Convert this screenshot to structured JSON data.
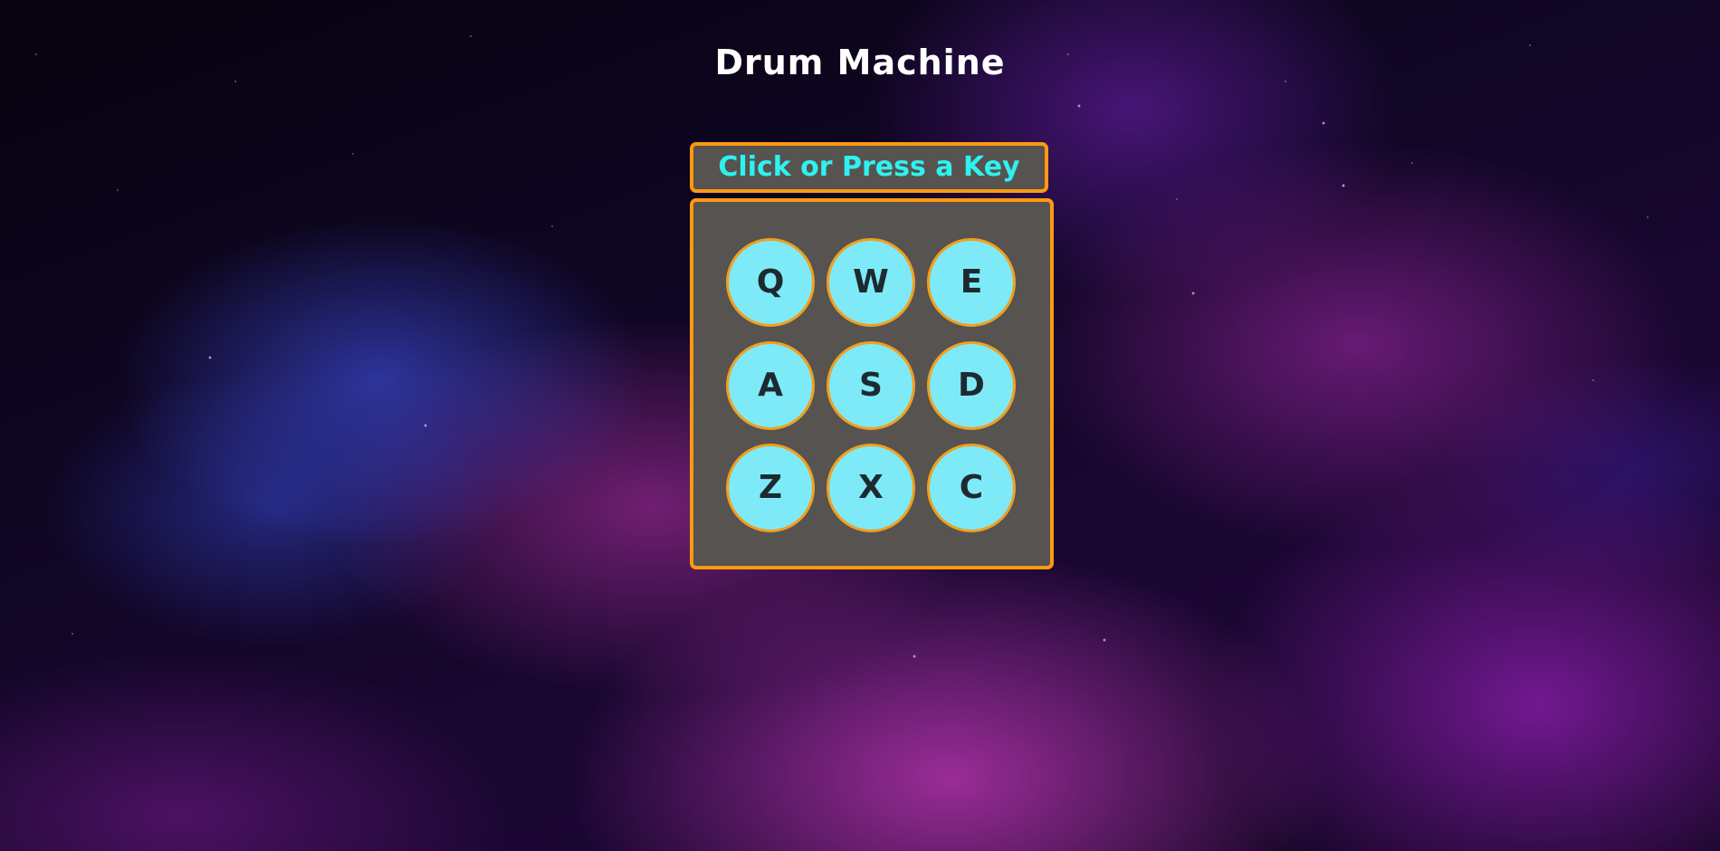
{
  "page": {
    "title": "Drum Machine"
  },
  "display": {
    "text": "Click or Press a Key"
  },
  "pads": [
    {
      "key": "Q"
    },
    {
      "key": "W"
    },
    {
      "key": "E"
    },
    {
      "key": "A"
    },
    {
      "key": "S"
    },
    {
      "key": "D"
    },
    {
      "key": "Z"
    },
    {
      "key": "X"
    },
    {
      "key": "C"
    }
  ],
  "colors": {
    "accent_border": "#ff9910",
    "panel_background": "#575350",
    "display_text": "#2ef2f0",
    "pad_fill": "#7eeaf8",
    "title_text": "#ffffff"
  }
}
